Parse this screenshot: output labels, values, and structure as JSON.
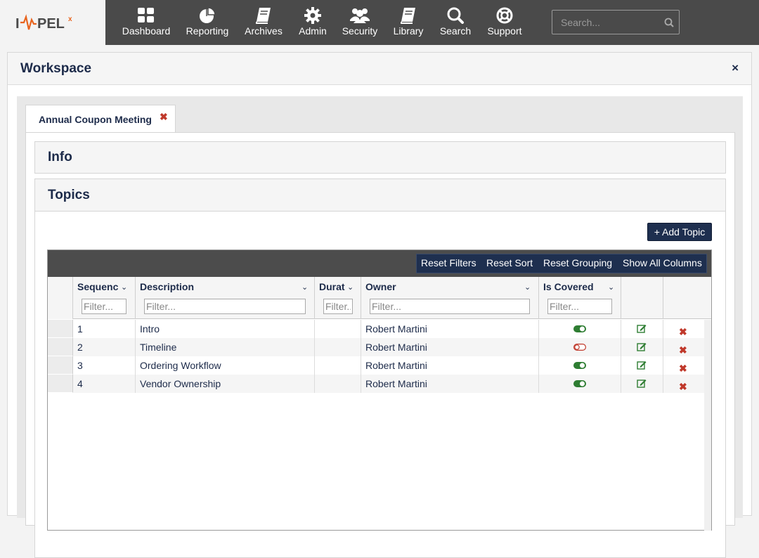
{
  "brand": {
    "logo_text": "IMPEL",
    "logo_sup": "x"
  },
  "nav": [
    {
      "label": "Dashboard",
      "icon": "dashboard-icon"
    },
    {
      "label": "Reporting",
      "icon": "pie-chart-icon"
    },
    {
      "label": "Archives",
      "icon": "book-icon"
    },
    {
      "label": "Admin",
      "icon": "gear-icon"
    },
    {
      "label": "Security",
      "icon": "users-icon"
    },
    {
      "label": "Library",
      "icon": "book-icon"
    },
    {
      "label": "Search",
      "icon": "search-icon"
    },
    {
      "label": "Support",
      "icon": "life-ring-icon"
    }
  ],
  "search": {
    "placeholder": "Search..."
  },
  "workspace": {
    "title": "Workspace",
    "close": "×"
  },
  "tab": {
    "label": "Annual Coupon Meeting",
    "close": "✖"
  },
  "sections": {
    "info": "Info",
    "topics": "Topics"
  },
  "add_topic": "+ Add Topic",
  "toolbar": [
    "Reset Filters",
    "Reset Sort",
    "Reset Grouping",
    "Show All Columns"
  ],
  "columns": [
    {
      "title": "Sequenc",
      "filter": "Filter..."
    },
    {
      "title": "Description",
      "filter": "Filter..."
    },
    {
      "title": "Durat",
      "filter": "Filter.."
    },
    {
      "title": "Owner",
      "filter": "Filter..."
    },
    {
      "title": "Is Covered",
      "filter": "Filter..."
    }
  ],
  "rows": [
    {
      "seq": "1",
      "description": "Intro",
      "owner": "Robert Martini",
      "covered": true
    },
    {
      "seq": "2",
      "description": "Timeline",
      "owner": "Robert Martini",
      "covered": false
    },
    {
      "seq": "3",
      "description": "Ordering Workflow",
      "owner": "Robert Martini",
      "covered": true
    },
    {
      "seq": "4",
      "description": "Vendor Ownership",
      "owner": "Robert Martini",
      "covered": true
    }
  ],
  "colors": {
    "nav_bg": "#4a4a4a",
    "accent_navy": "#1e2f4f",
    "toggle_on": "#2e7d32",
    "toggle_off": "#c0392b",
    "logo_orange": "#e8641e"
  }
}
